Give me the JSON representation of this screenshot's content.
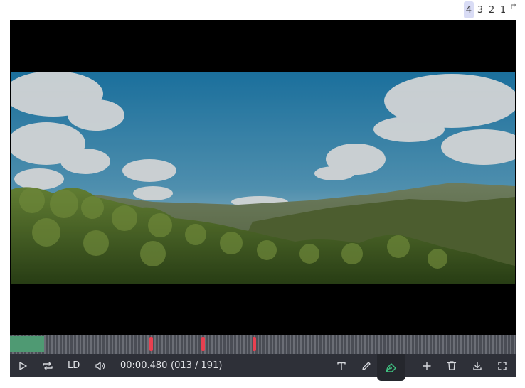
{
  "pagination": {
    "pages": [
      "4",
      "3",
      "2",
      "1"
    ],
    "active_page": "4",
    "icon": "corner-up-arrow-icon"
  },
  "video": {
    "scene": "cartoon forest hills under blue sky with clouds"
  },
  "timeline": {
    "played_fraction": 0.068,
    "keyframe_positions_fraction": [
      0.276,
      0.378,
      0.48
    ],
    "colors": {
      "played": "#4f9a73",
      "keyframe": "#e84050",
      "track": "#5d6068"
    }
  },
  "controls": {
    "quality_label": "LD",
    "current_time": "00:00.480",
    "frame_info": "(013 / 191)",
    "icons": [
      "play-icon",
      "loop-icon",
      "volume-icon",
      "text-tool-icon",
      "pencil-icon",
      "pen-tool-icon",
      "add-icon",
      "trash-icon",
      "download-icon",
      "fullscreen-icon"
    ],
    "active_tool": "pen-tool-icon",
    "accent": "#3fbf7f"
  }
}
